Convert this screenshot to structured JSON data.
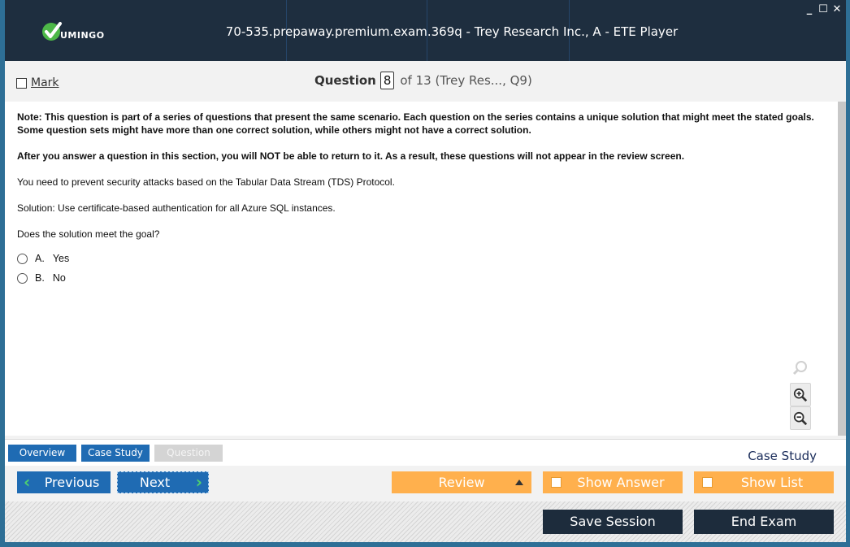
{
  "window": {
    "title": "70-535.prepaway.premium.exam.369q - Trey Research Inc., A - ETE Player",
    "logo_text": "UMINGO",
    "controls": {
      "minimize": "_",
      "maximize": "☐",
      "close": "✕"
    }
  },
  "header": {
    "mark_label": "Mark",
    "question_label": "Question",
    "question_number": "8",
    "question_suffix": "of 13 (Trey Res..., Q9)"
  },
  "content": {
    "note": "Note: This question is part of a series of questions that present the same scenario. Each question on the series contains a unique solution that might meet the stated goals. Some question sets might have more than one correct solution, while others might not have a correct solution.",
    "warning": "After you answer a question in this section, you will NOT be able to return to it. As a result, these questions will not appear in the review screen.",
    "scenario": "You need to prevent security attacks based on the Tabular Data Stream (TDS) Protocol.",
    "solution": "Solution: Use certificate-based authentication for all Azure SQL instances.",
    "prompt": "Does the solution meet the goal?",
    "options": [
      {
        "letter": "A.",
        "text": "Yes"
      },
      {
        "letter": "B.",
        "text": "No"
      }
    ]
  },
  "tabs": {
    "overview": "Overview",
    "case_study": "Case Study",
    "question": "Question",
    "section_label": "Case Study"
  },
  "nav": {
    "previous": "Previous",
    "next": "Next",
    "review": "Review",
    "show_answer": "Show Answer",
    "show_list": "Show List"
  },
  "footer": {
    "save_session": "Save Session",
    "end_exam": "End Exam"
  },
  "colors": {
    "titlebar": "#1e2e3f",
    "accent_blue": "#1f6bb3",
    "accent_orange": "#ffb04d",
    "dark_button": "#1d2c3c",
    "logo_check": "#4db848"
  }
}
